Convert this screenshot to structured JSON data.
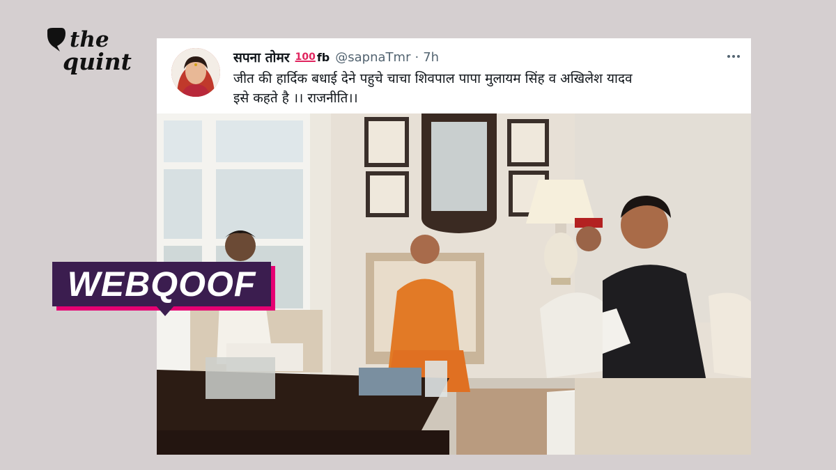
{
  "logo": {
    "line1": "the",
    "line2": "quint",
    "icon": "quint-quill-icon"
  },
  "tweet": {
    "display_name": "सपना तोमर",
    "badge_emoji": "100",
    "name_suffix": "fb",
    "handle": "@sapnaTmr",
    "separator": "·",
    "time": "7h",
    "more_icon": "more-horizontal-icon",
    "text_line1": "जीत की हार्दिक बधाई देने पहुचे चाचा शिवपाल पापा मुलायम सिंह व अखिलेश यादव",
    "text_line2": "इसे कहते है ।। राजनीति।।"
  },
  "badge": {
    "label": "WEBQOOF"
  },
  "colors": {
    "page_bg": "#d5cfd0",
    "badge_bg": "#3b1d4f",
    "badge_accent": "#e60073",
    "card_bg": "#ffffff",
    "muted_text": "#536471"
  }
}
